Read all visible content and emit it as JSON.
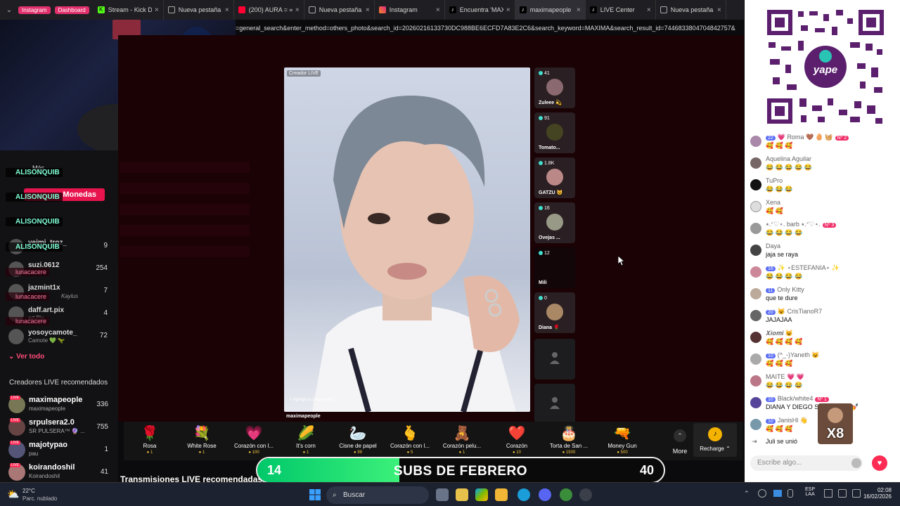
{
  "browser": {
    "pills": [
      "Instagram",
      "Dashboard"
    ],
    "tabs": [
      {
        "label": "Stream - Kick Da",
        "icon": "kick-icon"
      },
      {
        "label": "Nueva pestaña",
        "icon": "new-tab-icon"
      },
      {
        "label": "(200) AURA = ∞",
        "icon": "youtube-icon"
      },
      {
        "label": "Nueva pestaña",
        "icon": "new-tab-icon"
      },
      {
        "label": "Instagram",
        "icon": "instagram-icon"
      },
      {
        "label": "Encuentra 'MAXI",
        "icon": "tiktok-icon"
      },
      {
        "label": "maximapeople",
        "icon": "tiktok-icon"
      },
      {
        "label": "LIVE Center",
        "icon": "tiktok-icon"
      },
      {
        "label": "Nueva pestaña",
        "icon": "new-tab-icon"
      }
    ],
    "url": "=general_search&enter_method=others_photo&search_id=20260216133730DC988BE6ECFD7A83E2C6&search_keyword=MAXIMA&search_result_id=7446833804704842757&"
  },
  "overlay": {
    "tags": [
      "ALISONQUIB",
      "ALISONQUIB",
      "ALISONQUIB",
      "ALISONQUIB"
    ],
    "pink_tags": [
      "lunacacere",
      "lunacacere",
      "lunacacere"
    ],
    "coins_label": "Monedas",
    "partial_text": "Más"
  },
  "ranking": [
    {
      "name": "yeimi_troz_",
      "sub": "",
      "value": "9"
    },
    {
      "name": "suzi.0612",
      "sub": "",
      "value": "254"
    },
    {
      "name": "jazmint1x",
      "sub": "Kaylus",
      "value": "7"
    },
    {
      "name": "daff.art.pix",
      "sub": "art.Pix...",
      "value": "4"
    },
    {
      "name": "yosoycamote_",
      "sub": "Camote 💚 🦖",
      "value": "72"
    }
  ],
  "ver_todo": "Ver todo",
  "recommended": {
    "title": "Creadores LIVE recomendados",
    "items": [
      {
        "name": "maximapeople",
        "sub": "maximapeople",
        "value": "336"
      },
      {
        "name": "srpulsera2.0",
        "sub": "SR PULSERA™ 🔮 ...",
        "value": "755"
      },
      {
        "name": "majotypao",
        "sub": "pau",
        "value": "1"
      },
      {
        "name": "koirandoshil",
        "sub": "Koirandoshil",
        "value": "41"
      }
    ]
  },
  "live_recommended": "Transmisiones LIVE recomendadas",
  "video": {
    "creator_label": "Creador LIVE",
    "host": "maximapeople",
    "hint": "+ Agrega tu propia foto"
  },
  "guests": [
    {
      "count": "41",
      "name": "Zuleee 💫"
    },
    {
      "count": "91",
      "name": "Tomato..."
    },
    {
      "count": "1.8K",
      "name": "GATZU 😺"
    },
    {
      "count": "16",
      "name": "Ovejas ..."
    },
    {
      "count": "12",
      "name": "Mili"
    },
    {
      "count": "0",
      "name": "Diana 🌹"
    }
  ],
  "gifts": [
    {
      "icon": "🌹",
      "name": "Rosa",
      "price": "1"
    },
    {
      "icon": "💐",
      "name": "White Rose",
      "price": "1"
    },
    {
      "icon": "💗",
      "name": "Corazón con l...",
      "price": "100"
    },
    {
      "icon": "🌽",
      "name": "It's corn",
      "price": "1"
    },
    {
      "icon": "🦢",
      "name": "Cisne de papel",
      "price": "99"
    },
    {
      "icon": "🫰",
      "name": "Corazón con l...",
      "price": "5"
    },
    {
      "icon": "🧸",
      "name": "Corazón pelu...",
      "price": "1"
    },
    {
      "icon": "❤️",
      "name": "Corazón",
      "price": "10"
    },
    {
      "icon": "🎂",
      "name": "Torta de San ...",
      "price": "1500"
    },
    {
      "icon": "🔫",
      "name": "Money Gun",
      "price": "500"
    }
  ],
  "more_label": "More",
  "recharge_label": "Recharge",
  "subs": {
    "current": "14",
    "goal": "40",
    "label": "SUBS DE FEBRERO",
    "progress": 0.35
  },
  "chat": {
    "messages": [
      {
        "badge": "22",
        "user": "💗 Roma 🤎 🥚 🧺",
        "level": "Nº 2",
        "text": "🥰 🥰 🥰"
      },
      {
        "badge": "",
        "user": "Aquelina Aguilar",
        "level": "",
        "text": "😂 😂 😂 😂 😂"
      },
      {
        "badge": "",
        "user": "TuPro",
        "level": "",
        "text": "😂 😂 😂"
      },
      {
        "badge": "",
        "user": "Xena",
        "level": "",
        "text": "🥰 🥰"
      },
      {
        "badge": "",
        "user": "⭑.ᐟ♡⋆. barb ⭑.ᐟ♡⋆.",
        "level": "Nº 3",
        "text": "😂 😂 😂 😂"
      },
      {
        "badge": "",
        "user": "Daya",
        "level": "",
        "text": "jaja se raya"
      },
      {
        "badge": "16",
        "user": "✨ ⋆ESTEFANIA⋆ ✨",
        "level": "",
        "text": "😂 😂 😂 😂"
      },
      {
        "badge": "11",
        "user": "Only Kitty",
        "level": "",
        "text": "que te dure"
      },
      {
        "badge": "20",
        "user": "😺 CrisTianoR7",
        "level": "",
        "text": "JAJAJAA"
      },
      {
        "badge": "",
        "user": "𝑿𝒊𝒐𝒎𝒊 😺",
        "level": "",
        "text": "🥰 🥰 🥰 🥰"
      },
      {
        "badge": "10",
        "user": "(^_-)Yaneth 😺",
        "level": "",
        "text": "🥰 🥰 🥰"
      },
      {
        "badge": "",
        "user": "MAITE 💗 💗",
        "level": "",
        "text": "😂 😂 😂 😂"
      },
      {
        "badge": "10",
        "user": "Black/white4",
        "level": "Nº 1",
        "text": "DIANA Y DIEGO SE CASTAA 💅"
      },
      {
        "badge": "10",
        "user": "JanisHl 👋",
        "level": "",
        "text": "🥰 🥰 🥰"
      },
      {
        "badge": "",
        "user": "Juli",
        "level": "",
        "text": "se unió"
      }
    ],
    "input_placeholder": "Escribe algo...",
    "x8": "X8"
  },
  "taskbar": {
    "temp": "22°C",
    "weather": "Parc. nublado",
    "search": "Buscar",
    "lang_top": "ESP",
    "lang_bottom": "LAA",
    "time": "02:08",
    "date": "16/02/2026"
  }
}
